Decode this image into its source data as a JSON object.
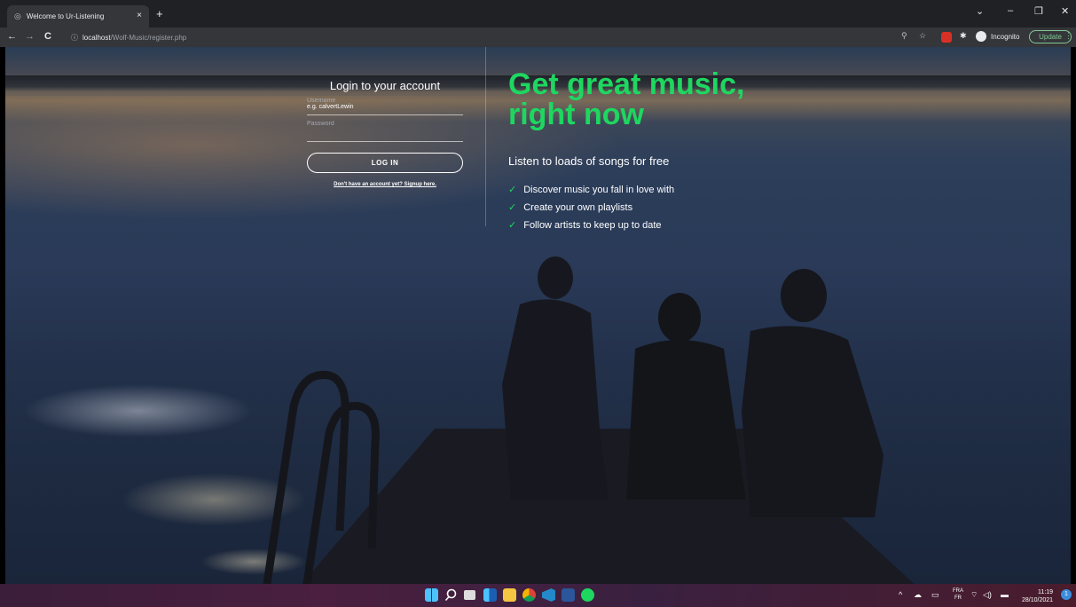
{
  "browser": {
    "tab_title": "Welcome to Ur-Listening",
    "tab_close": "×",
    "new_tab": "+",
    "url_host": "localhost",
    "url_path": "/Wolf-Music/register.php",
    "incognito_label": "Incognito",
    "update_label": "Update",
    "minimize": "–",
    "restore": "❐",
    "close": "✕",
    "tab_search": "⌄",
    "back": "←",
    "forward": "→",
    "reload": "C",
    "info": "ⓘ",
    "zoom": "⚲",
    "star": "☆",
    "puzzle": "✱",
    "menu": "⋮"
  },
  "login": {
    "title": "Login to your account",
    "username_label": "Username",
    "username_value": "e.g. calvertLewin",
    "password_label": "Password",
    "button_label": "LOG IN",
    "signup_link": "Don't have an account yet? Signup here."
  },
  "promo": {
    "headline_line1": "Get great music,",
    "headline_line2": "right now",
    "subtitle": "Listen to loads of songs for free",
    "features": [
      "Discover music you fall in love with",
      "Create your own playlists",
      "Follow artists to keep up to date"
    ],
    "check": "✓"
  },
  "taskbar": {
    "lang_top": "FRA",
    "lang_bottom": "FR",
    "time": "11:19",
    "date": "28/10/2021",
    "tray_up": "^",
    "wifi": "⌔",
    "speaker": "◁)",
    "notification_count": "1"
  },
  "colors": {
    "accent": "#1ed760",
    "update": "#81c995"
  }
}
